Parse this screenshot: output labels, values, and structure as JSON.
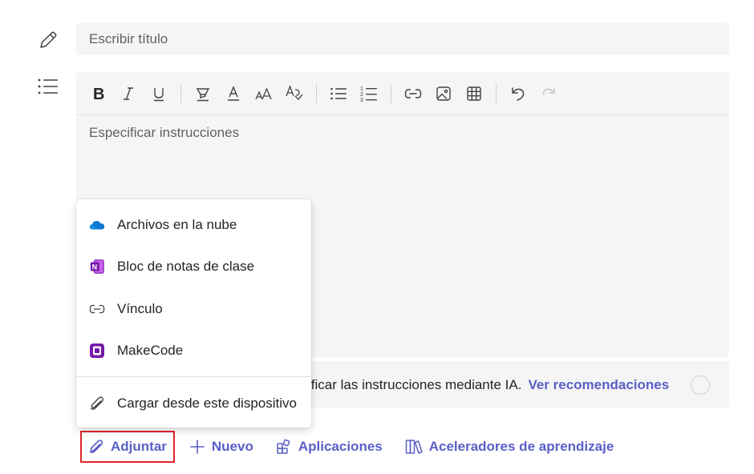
{
  "title_field": {
    "placeholder": "Escribir título"
  },
  "editor": {
    "placeholder": "Especificar instrucciones",
    "toolbar": [
      {
        "name": "bold-button",
        "icon": "bold-icon"
      },
      {
        "name": "italic-button",
        "icon": "italic-icon"
      },
      {
        "name": "underline-button",
        "icon": "underline-icon"
      },
      {
        "name": "highlight-button",
        "icon": "highlighter-icon"
      },
      {
        "name": "font-color-button",
        "icon": "font-color-icon"
      },
      {
        "name": "font-size-button",
        "icon": "font-size-icon"
      },
      {
        "name": "formatting-button",
        "icon": "text-format-icon"
      },
      {
        "name": "bulleted-list-button",
        "icon": "bullet-list-icon"
      },
      {
        "name": "numbered-list-button",
        "icon": "numbered-list-icon"
      },
      {
        "name": "insert-link-button",
        "icon": "link-icon"
      },
      {
        "name": "insert-image-button",
        "icon": "image-icon"
      },
      {
        "name": "insert-table-button",
        "icon": "table-icon"
      },
      {
        "name": "undo-button",
        "icon": "undo-icon"
      },
      {
        "name": "redo-button",
        "icon": "redo-icon"
      }
    ]
  },
  "ai_bar": {
    "text": "ificar las instrucciones mediante IA.",
    "link": "Ver recomendaciones"
  },
  "attach_menu": {
    "items": [
      {
        "label": "Archivos en la nube",
        "icon": "onedrive-cloud-icon"
      },
      {
        "label": "Bloc de notas de clase",
        "icon": "onenote-icon"
      },
      {
        "label": "Vínculo",
        "icon": "link-icon"
      },
      {
        "label": "MakeCode",
        "icon": "makecode-icon"
      }
    ],
    "upload": {
      "label": "Cargar desde este dispositivo",
      "icon": "paperclip-icon"
    }
  },
  "actions": {
    "attach": "Adjuntar",
    "new": "Nuevo",
    "apps": "Aplicaciones",
    "accelerators": "Aceleradores de aprendizaje"
  },
  "colors": {
    "accent": "#5b5fc7",
    "highlight_border": "#e0242b",
    "onenote": "#7719aa",
    "onedrive": "#0f78d4"
  }
}
